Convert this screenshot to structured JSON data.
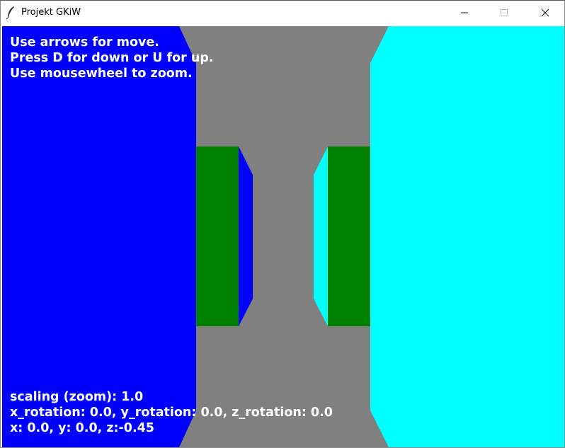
{
  "window": {
    "title": "Projekt GKiW",
    "app_icon": "feather-icon",
    "controls": [
      "minimize-icon",
      "maximize-icon",
      "close-icon"
    ]
  },
  "instructions": {
    "line1": "Use arrows for move.",
    "line2": "Press D for down or U for up.",
    "line3": "Use mousewheel to zoom."
  },
  "status": {
    "scaling": "scaling (zoom): 1.0",
    "rotation": "x_rotation: 0.0, y_rotation: 0.0, z_rotation: 0.0",
    "position": "x: 0.0, y: 0.0, z:-0.45"
  },
  "colors": {
    "left_wall": "#0000ff",
    "right_wall": "#00ffff",
    "floor_ceiling": "#808080",
    "blocks": "#008000",
    "text": "#ffffff"
  }
}
